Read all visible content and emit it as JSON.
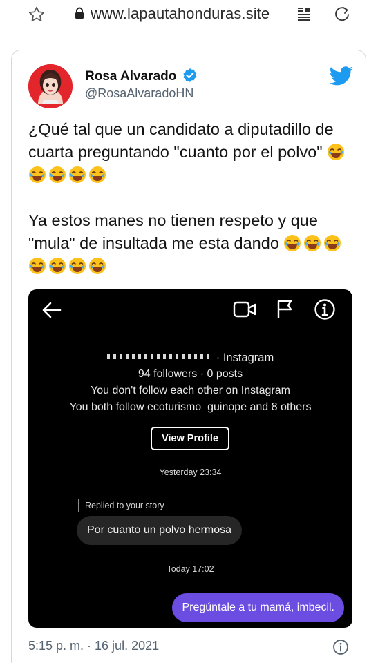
{
  "browser": {
    "url": "www.lapautahonduras.site"
  },
  "tweet": {
    "display_name": "Rosa Alvarado",
    "handle": "@RosaAlvaradoHN",
    "paragraph1": "¿Qué tal que un candidato a diputadillo de cuarta preguntando \"cuanto por el polvo\"",
    "paragraph2": "Ya estos manes no tienen respeto y que \"mula\" de insultada me esta dando",
    "timestamp": "5:15 p. m. · 16 jul. 2021",
    "colors": {
      "verified": "#1d9bf0",
      "bird": "#1d9bf0",
      "handle": "#566370"
    }
  },
  "screenshot": {
    "profile_suffix": "· Instagram",
    "followers": "94 followers · 0 posts",
    "follow_each": "You don't follow each other on Instagram",
    "both_follow": "You both follow ecoturismo_guinope and 8 others",
    "view_profile": "View Profile",
    "ts_yesterday": "Yesterday 23:34",
    "replied_label": "Replied to your story",
    "incoming_message": "Por cuanto un polvo hermosa",
    "ts_today": "Today 17:02",
    "outgoing_message": "Pregúntale a tu mamá, imbecil.",
    "colors": {
      "outgoing_bubble": "#6c4de2",
      "incoming_bubble": "#262626"
    }
  },
  "icons": [
    "star-icon",
    "lock-icon",
    "reader-mode-icon",
    "refresh-icon",
    "verified-badge-icon",
    "twitter-bird-icon",
    "laughing-emoji-icon",
    "back-arrow-icon",
    "video-call-icon",
    "report-flag-icon",
    "info-icon"
  ]
}
